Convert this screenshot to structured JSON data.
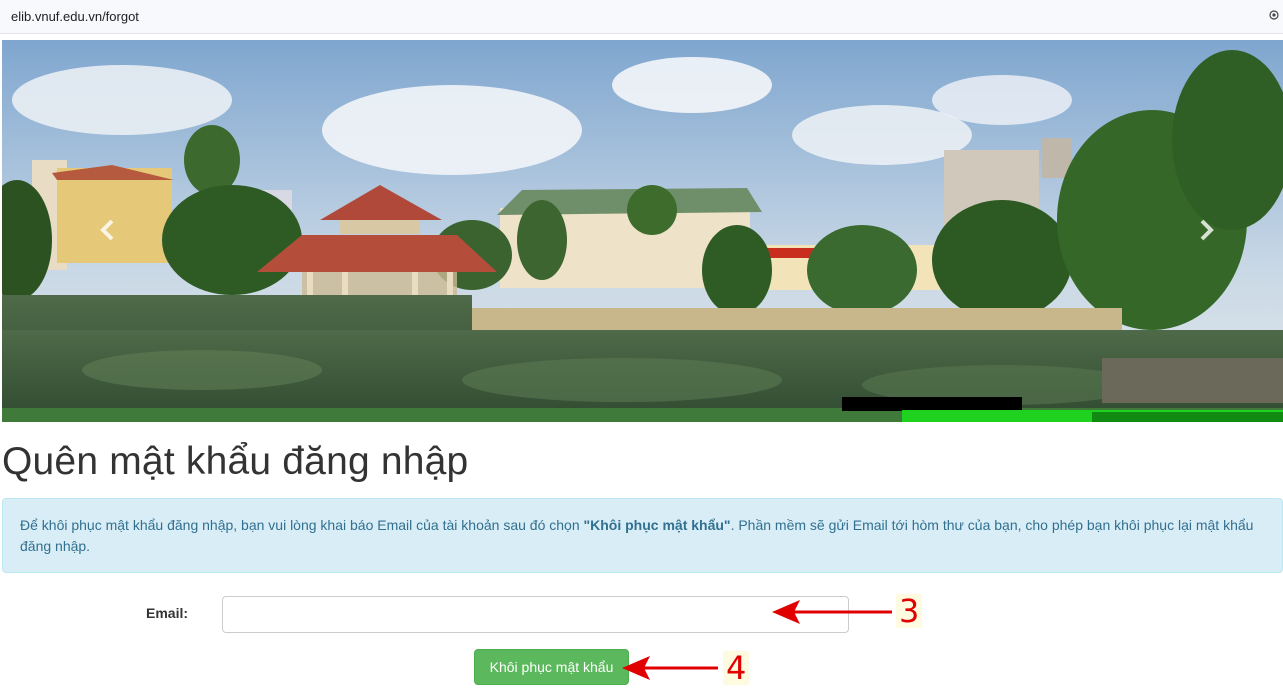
{
  "browser": {
    "url": "elib.vnuf.edu.vn/forgot",
    "site_info_icon": "site-info-icon"
  },
  "banner": {
    "prev_icon": "chevron-left-icon",
    "next_icon": "chevron-right-icon"
  },
  "page": {
    "title": "Quên mật khẩu đăng nhập",
    "info_before": "Để khôi phục mật khẩu đăng nhập, bạn vui lòng khai báo Email của tài khoản sau đó chọn ",
    "info_bold": "\"Khôi phục mật khẩu\"",
    "info_after": ". Phần mềm sẽ gửi Email tới hòm thư của bạn, cho phép bạn khôi phục lại mật khẩu đăng nhập."
  },
  "form": {
    "email_label": "Email:",
    "email_value": "",
    "submit_label": "Khôi phục mật khẩu"
  },
  "annotations": [
    {
      "label": "3",
      "color": "#e00000"
    },
    {
      "label": "4",
      "color": "#e00000"
    }
  ]
}
